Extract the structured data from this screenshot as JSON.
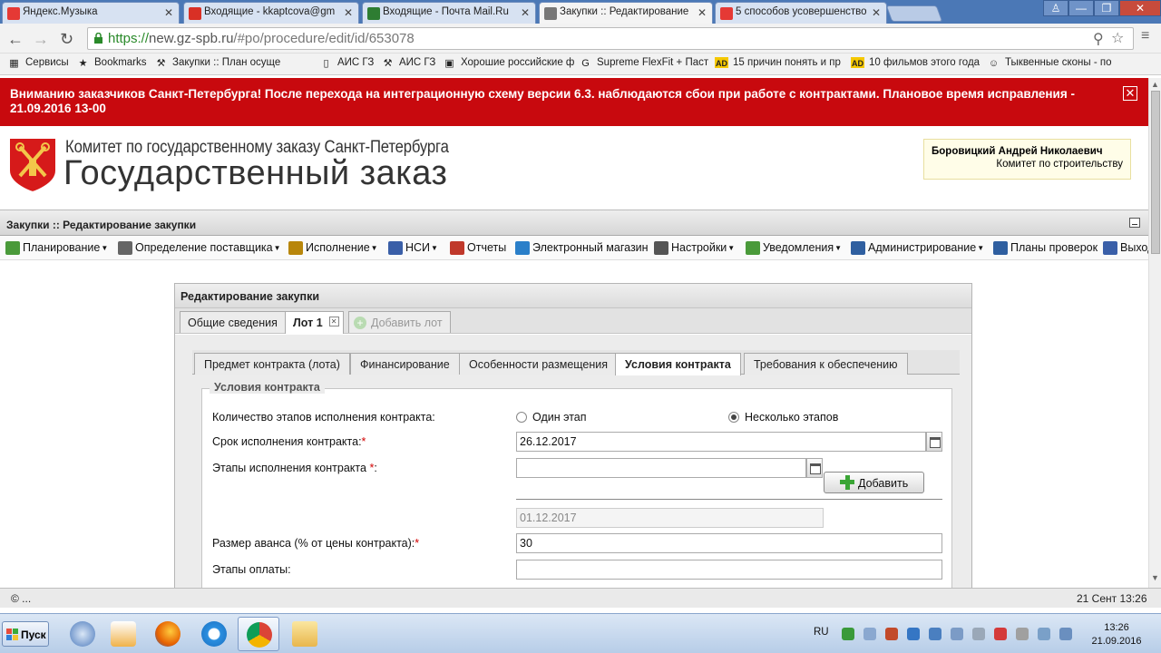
{
  "browser": {
    "tabs": [
      {
        "label": "Яндекс.Музыка",
        "active": false,
        "color": "#e53935"
      },
      {
        "label": "Входящие - kkaptcova@gm",
        "active": false,
        "color": "#d93025"
      },
      {
        "label": "Входящие - Почта Mail.Ru",
        "active": false,
        "color": "#2e7d32"
      },
      {
        "label": "Закупки :: Редактирование",
        "active": true,
        "color": "#777777"
      },
      {
        "label": "5 способов усовершенство",
        "active": false,
        "color": "#e53935"
      }
    ],
    "url_secure": "https://",
    "url_host": "new.gz-spb.ru",
    "url_path": "/#po/procedure/edit/id/653078",
    "bookmarks": [
      {
        "label": "Сервисы",
        "icon": "apps-icon"
      },
      {
        "label": "Bookmarks",
        "icon": "star-icon"
      },
      {
        "label": "Закупки :: План осуще",
        "icon": "tools-icon"
      },
      {
        "label": "",
        "icon": "tools-icon"
      },
      {
        "label": "АИС ГЗ",
        "icon": "page-icon"
      },
      {
        "label": "АИС ГЗ",
        "icon": "tools-icon"
      },
      {
        "label": "Хорошие российские ф",
        "icon": "photo-icon"
      },
      {
        "label": "Supreme FlexFit + Паст",
        "icon": "g-icon"
      },
      {
        "label": "15 причин понять и пр",
        "icon": "ad-icon"
      },
      {
        "label": "10 фильмов этого года",
        "icon": "ad-icon"
      },
      {
        "label": "Тыквенные сконы - по",
        "icon": "person-icon"
      }
    ]
  },
  "banner": {
    "text": "Вниманию заказчиков Санкт-Петербурга! После перехода на интеграционную схему версии 6.3. наблюдаются сбои при работе с контрактами. Плановое время исправления - 21.09.2016 13-00",
    "close": "✕"
  },
  "header": {
    "org_name": "Комитет по государственному заказу Санкт-Петербурга",
    "site_title": "Государственный заказ",
    "user_name": "Боровицкий Андрей Николаевич",
    "user_org": "Комитет по строительству"
  },
  "page_title": "Закупки :: Редактирование закупки",
  "menu": [
    {
      "label": "Планирование",
      "dropdown": true,
      "color": "#4a9a3a"
    },
    {
      "label": "Определение поставщика",
      "dropdown": true,
      "color": "#666666"
    },
    {
      "label": "Исполнение",
      "dropdown": true,
      "color": "#b8860b"
    },
    {
      "label": "НСИ",
      "dropdown": true,
      "color": "#3a5fa8"
    },
    {
      "label": "Отчеты",
      "dropdown": false,
      "color": "#c0392b"
    },
    {
      "label": "Электронный магазин",
      "dropdown": false,
      "color": "#2a7fc9"
    },
    {
      "label": "Настройки",
      "dropdown": true,
      "color": "#555555"
    },
    {
      "label": "Уведомления",
      "dropdown": true,
      "color": "#4a9a3a"
    },
    {
      "label": "Администрирование",
      "dropdown": true,
      "color": "#2f5fa0"
    },
    {
      "label": "Планы проверок",
      "dropdown": false,
      "color": "#2f5fa0"
    },
    {
      "label": "Выход",
      "dropdown": false,
      "color": "#3a5fa8"
    }
  ],
  "panel": {
    "title": "Редактирование закупки",
    "lot_tabs": [
      {
        "label": "Общие сведения",
        "state": "normal"
      },
      {
        "label": "Лот 1",
        "state": "active"
      },
      {
        "label": "Добавить лот",
        "state": "disabled"
      }
    ],
    "cond_tabs": [
      {
        "label": "Предмет контракта (лота)",
        "active": false
      },
      {
        "label": "Финансирование",
        "active": false
      },
      {
        "label": "Особенности размещения",
        "active": false
      },
      {
        "label": "Условия контракта",
        "active": true
      },
      {
        "label": "Требования к обеспечению",
        "active": false
      }
    ],
    "section_title": "Условия контракта",
    "stages_label": "Количество этапов исполнения контракта:",
    "stage_options": [
      {
        "label": "Один этап",
        "selected": false
      },
      {
        "label": "Несколько этапов",
        "selected": true
      }
    ],
    "term_label": "Срок исполнения контракта:",
    "term_value": "26.12.2017",
    "stages_field_label": "Этапы исполнения контракта",
    "stages_field_value": "",
    "add_button": "Добавить",
    "stage_date": "01.12.2017",
    "advance_label": "Размер аванса (% от цены контракта):",
    "advance_value": "30",
    "payment_label": "Этапы оплаты:",
    "payment_value": "",
    "required_mark": "*",
    "colon": ":"
  },
  "status": {
    "left": "© ...",
    "right": "21 Сент 13:26"
  },
  "taskbar": {
    "start": "Пуск",
    "lang": "RU",
    "time": "13:26",
    "date": "21.09.2016"
  }
}
